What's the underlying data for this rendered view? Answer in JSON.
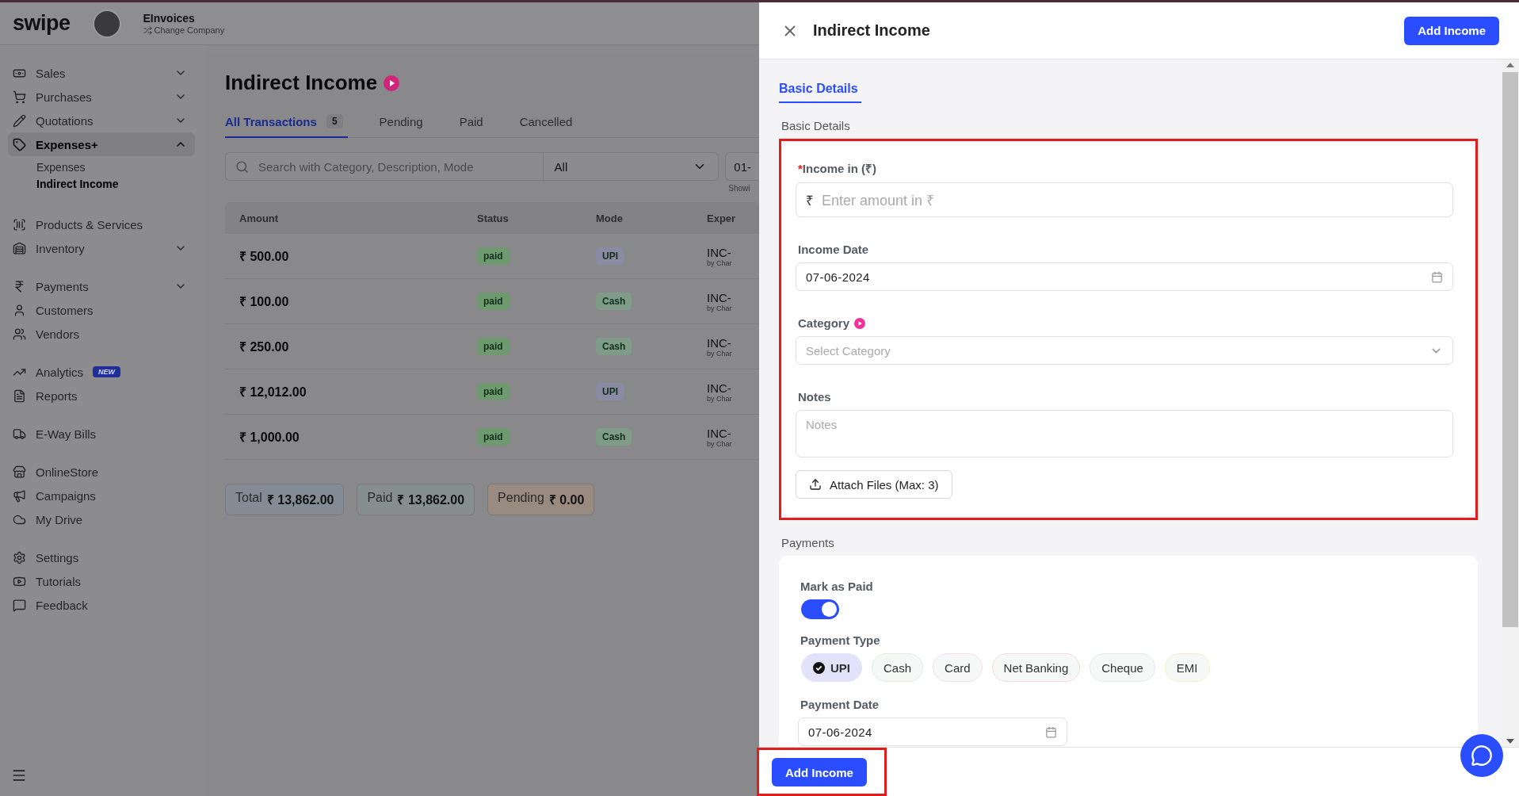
{
  "header": {
    "logo": "swipe",
    "company": "EInvoices",
    "switch_label": "Change Company"
  },
  "sidebar": {
    "groups": [
      [
        {
          "label": "Sales",
          "expanded": false,
          "selected": false
        },
        {
          "label": "Purchases",
          "expanded": false,
          "selected": false
        },
        {
          "label": "Quotations",
          "expanded": false,
          "selected": false
        },
        {
          "label": "Expenses+",
          "expanded": true,
          "selected": true,
          "children": [
            {
              "label": "Expenses",
              "selected": false
            },
            {
              "label": "Indirect Income",
              "selected": true
            }
          ]
        }
      ],
      [
        {
          "label": "Products & Services",
          "selected": false
        },
        {
          "label": "Inventory",
          "expanded": false,
          "selected": false
        }
      ],
      [
        {
          "label": "Payments",
          "expanded": false,
          "selected": false
        },
        {
          "label": "Customers",
          "selected": false
        },
        {
          "label": "Vendors",
          "selected": false
        }
      ],
      [
        {
          "label": "Analytics",
          "badge": "NEW",
          "selected": false
        },
        {
          "label": "Reports",
          "selected": false
        }
      ],
      [
        {
          "label": "E-Way Bills",
          "selected": false
        }
      ],
      [
        {
          "label": "OnlineStore",
          "selected": false
        },
        {
          "label": "Campaigns",
          "selected": false
        },
        {
          "label": "My Drive",
          "selected": false
        }
      ],
      [
        {
          "label": "Settings",
          "selected": false
        },
        {
          "label": "Tutorials",
          "selected": false
        },
        {
          "label": "Feedback",
          "selected": false
        }
      ]
    ]
  },
  "page": {
    "title": "Indirect Income",
    "tabs": [
      {
        "label": "All Transactions",
        "count": "5",
        "selected": true
      },
      {
        "label": "Pending",
        "selected": false
      },
      {
        "label": "Paid",
        "selected": false
      },
      {
        "label": "Cancelled",
        "selected": false
      }
    ],
    "search": {
      "placeholder": "Search with Category, Description, Mode"
    },
    "filter": {
      "value": "All"
    },
    "date_range": {
      "value": "01-",
      "note": "Showi"
    },
    "table": {
      "columns": [
        "Amount",
        "Status",
        "Mode",
        "Exper"
      ],
      "rows": [
        {
          "amount": "₹ 500.00",
          "status": "paid",
          "mode": {
            "label": "UPI",
            "color": "#8a8aa2"
          },
          "column_4": "INC-",
          "column_4_sub": "by Char"
        },
        {
          "amount": "₹ 100.00",
          "status": "paid",
          "mode": {
            "label": "Cash",
            "color": "#7e9c88"
          },
          "column_4": "INC-",
          "column_4_sub": "by Char"
        },
        {
          "amount": "₹ 250.00",
          "status": "paid",
          "mode": {
            "label": "Cash",
            "color": "#7e9c88"
          },
          "column_4": "INC-",
          "column_4_sub": "by Char"
        },
        {
          "amount": "₹ 12,012.00",
          "status": "paid",
          "mode": {
            "label": "UPI",
            "color": "#8a8aa2"
          },
          "column_4": "INC-",
          "column_4_sub": "by Char"
        },
        {
          "amount": "₹ 1,000.00",
          "status": "paid",
          "mode": {
            "label": "Cash",
            "color": "#7e9c88"
          },
          "column_4": "INC-",
          "column_4_sub": "by Char"
        }
      ]
    },
    "totals": [
      {
        "label": "Total",
        "value": "₹ 13,862.00",
        "color": "#838c94"
      },
      {
        "label": "Paid",
        "value": "₹ 13,862.00",
        "color": "#858f8e"
      },
      {
        "label": "Pending",
        "value": "₹ 0.00",
        "color": "#9a8b80"
      }
    ]
  },
  "drawer": {
    "title": "Indirect Income",
    "add_button": "Add Income",
    "tabs": [
      {
        "label": "Basic Details",
        "selected": true
      }
    ],
    "basic_section": {
      "title": "Basic Details",
      "highlighted": true,
      "amount": {
        "label": "Income in (₹)",
        "required_mark": "*",
        "prefix": "₹",
        "placeholder": "Enter amount in ₹"
      },
      "date": {
        "label": "Income Date",
        "value": "07-06-2024"
      },
      "category": {
        "label": "Category",
        "placeholder": "Select Category"
      },
      "notes": {
        "label": "Notes",
        "placeholder": "Notes"
      },
      "attach_button": "Attach Files (Max: 3)"
    },
    "payments": {
      "title": "Payments",
      "mark_as_paid": {
        "label": "Mark as Paid",
        "on": true
      },
      "type_label": "Payment Type",
      "types": [
        {
          "label": "UPI",
          "selected": true,
          "color": "#e2e3fb"
        },
        {
          "label": "Cash",
          "selected": false,
          "color": "#d8f1e2"
        },
        {
          "label": "Card",
          "selected": false,
          "color": "#f5dbf0"
        },
        {
          "label": "Net Banking",
          "selected": false,
          "color": "#f8dada"
        },
        {
          "label": "Cheque",
          "selected": false,
          "color": "#e3eaf0"
        },
        {
          "label": "EMI",
          "selected": false,
          "color": "#f5f1c4"
        }
      ],
      "date": {
        "label": "Payment Date",
        "value": "07-06-2024"
      }
    },
    "footer": {
      "button": "Add Income",
      "highlighted": true
    }
  }
}
